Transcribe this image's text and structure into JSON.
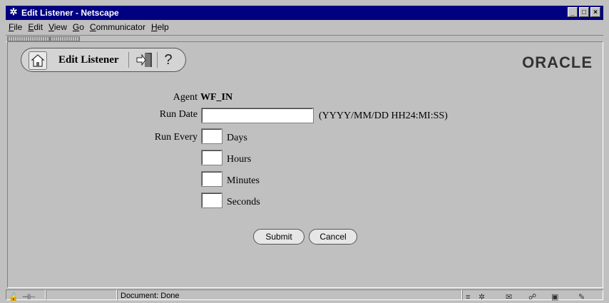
{
  "window": {
    "title": "Edit Listener - Netscape",
    "controls": {
      "minimize": "_",
      "maximize": "□",
      "close": "×"
    }
  },
  "menu": {
    "items": [
      {
        "accel": "F",
        "rest": "ile"
      },
      {
        "accel": "E",
        "rest": "dit"
      },
      {
        "accel": "V",
        "rest": "iew"
      },
      {
        "accel": "G",
        "rest": "o"
      },
      {
        "accel": "C",
        "rest": "ommunicator"
      },
      {
        "accel": "H",
        "rest": "elp"
      }
    ]
  },
  "toolbar": {
    "heading": "Edit Listener",
    "help_glyph": "?",
    "icons": [
      "home-icon",
      "exit-icon",
      "help-icon"
    ]
  },
  "brand": {
    "logo_text": "ORACLE"
  },
  "form": {
    "agent_label": "Agent",
    "agent_value": "WF_IN",
    "run_date_label": "Run Date",
    "run_date_value": "",
    "run_date_format": "(YYYY/MM/DD HH24:MI:SS)",
    "run_every_label": "Run Every",
    "days_label": "Days",
    "hours_label": "Hours",
    "minutes_label": "Minutes",
    "seconds_label": "Seconds",
    "days_value": "",
    "hours_value": "",
    "minutes_value": "",
    "seconds_value": ""
  },
  "actions": {
    "submit": "Submit",
    "cancel": "Cancel"
  },
  "status": {
    "text": "Document: Done"
  }
}
